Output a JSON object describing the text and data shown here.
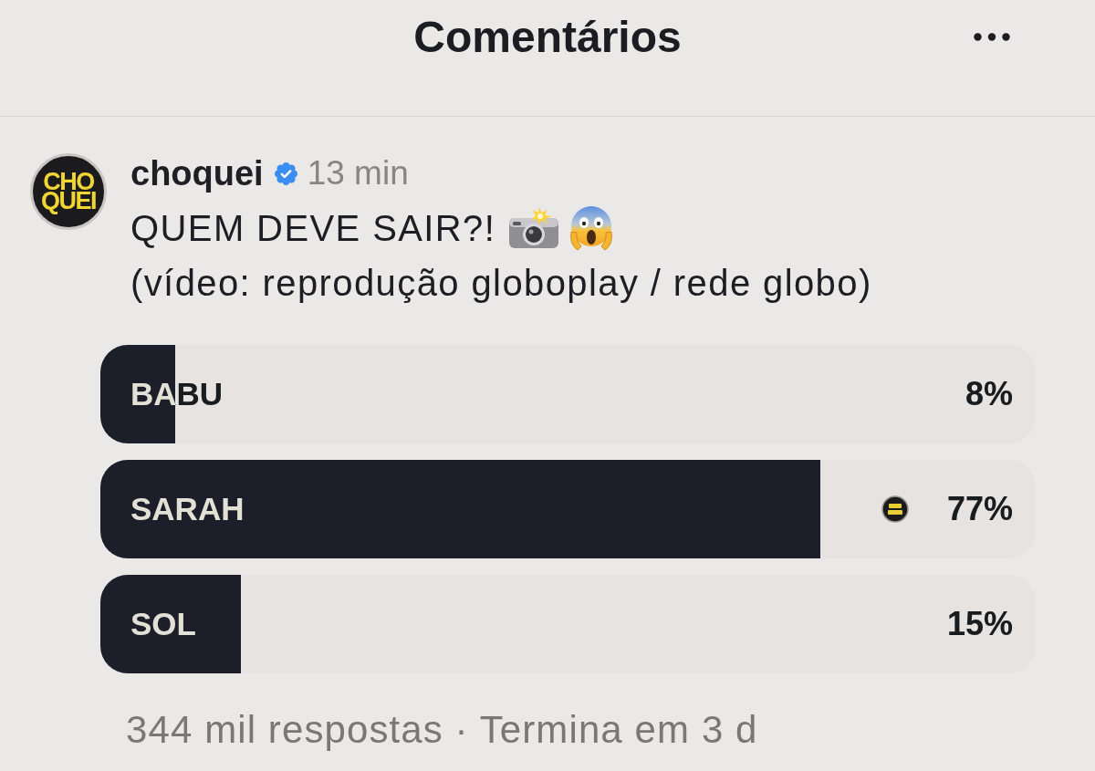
{
  "header": {
    "title": "Comentários"
  },
  "post": {
    "avatar_text": [
      "CHO",
      "QUEI"
    ],
    "username": "choquei",
    "verified": true,
    "time": "13 min",
    "lines": [
      "QUEM DEVE SAIR?!",
      "(vídeo: reprodução globoplay / rede globo)"
    ]
  },
  "poll": {
    "options": [
      {
        "label": "BABU",
        "percent": "8%",
        "level": 0.08,
        "voted": false
      },
      {
        "label": "SARAH",
        "percent": "77%",
        "level": 0.77,
        "voted": true
      },
      {
        "label": "SOL",
        "percent": "15%",
        "level": 0.15,
        "voted": false
      }
    ],
    "summary": "344 mil respostas · Termina em 3 d"
  }
}
